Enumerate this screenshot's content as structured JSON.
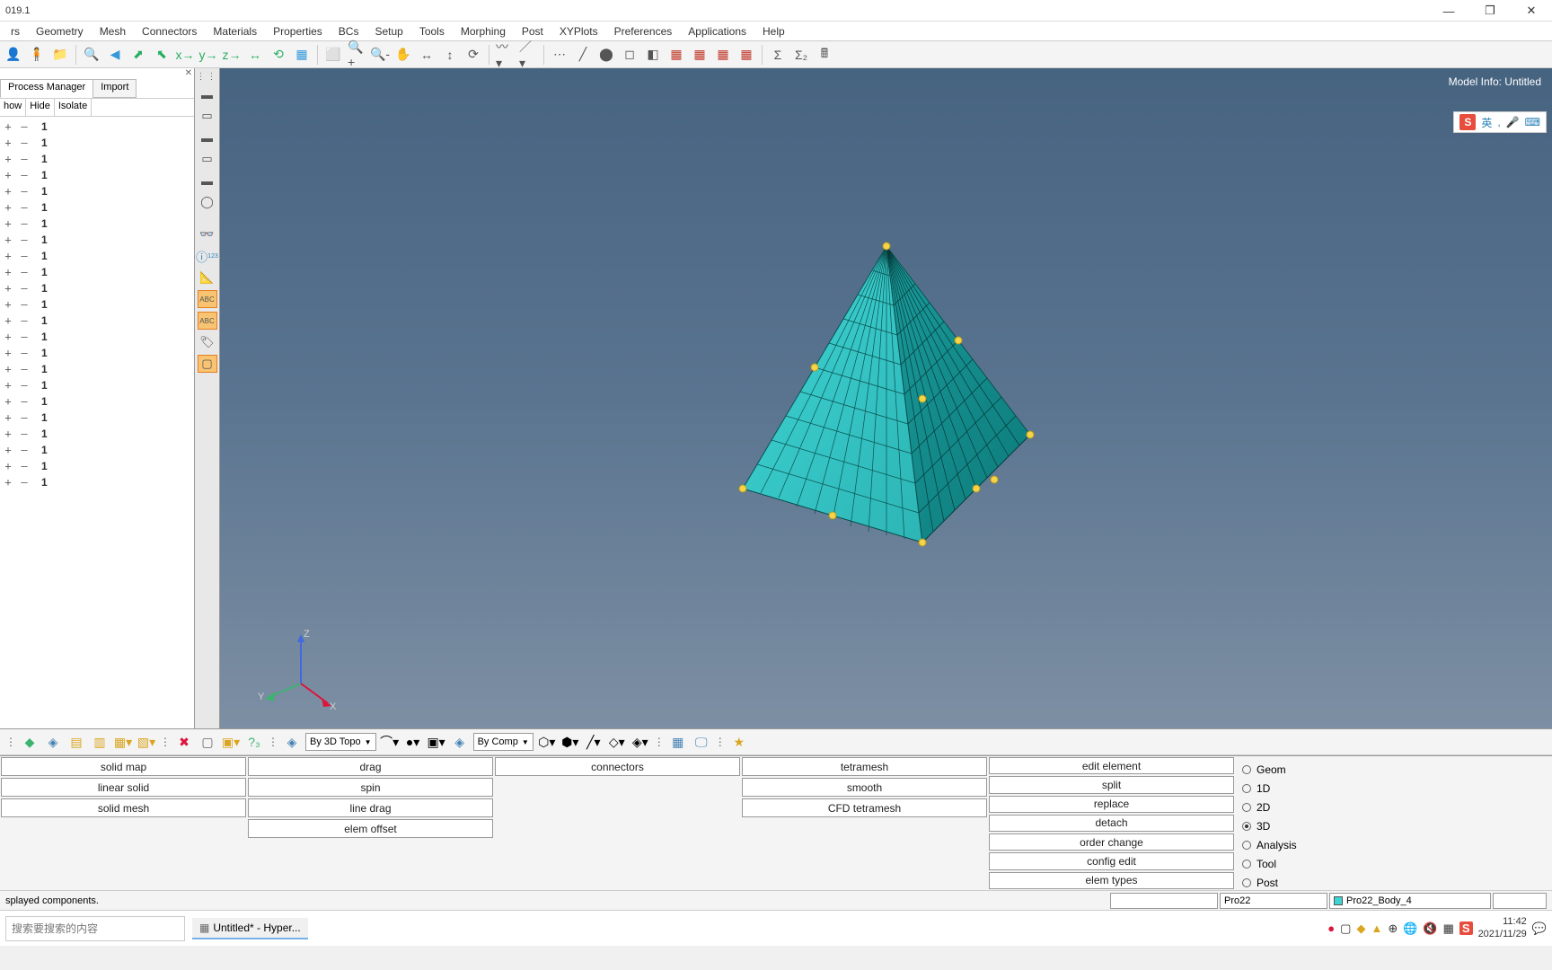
{
  "title": "019.1",
  "menu": [
    "rs",
    "Geometry",
    "Mesh",
    "Connectors",
    "Materials",
    "Properties",
    "BCs",
    "Setup",
    "Tools",
    "Morphing",
    "Post",
    "XYPlots",
    "Preferences",
    "Applications",
    "Help"
  ],
  "left_panel": {
    "tabs": [
      "Process Manager",
      "Import"
    ],
    "filters": [
      "how",
      "Hide",
      "Isolate"
    ],
    "tree_count": 23,
    "tree_value": "1"
  },
  "viewport": {
    "model_info": "Model Info: Untitled",
    "ime": {
      "mark": "S",
      "lang": "英",
      "bits": ",",
      "m1": "🎤",
      "m2": "⌨"
    },
    "axes": {
      "x": "X",
      "y": "Y",
      "z": "Z"
    }
  },
  "bottom_combo1": "By 3D Topo",
  "bottom_combo2": "By Comp",
  "panel": {
    "col1": [
      "solid map",
      "linear solid",
      "solid mesh"
    ],
    "col2": [
      "drag",
      "spin",
      "line drag",
      "elem offset"
    ],
    "col3": [
      "connectors"
    ],
    "col4": [
      "tetramesh",
      "smooth",
      "CFD tetramesh"
    ],
    "col5": [
      "edit element",
      "split",
      "replace",
      "detach",
      "order change",
      "config edit",
      "elem types"
    ],
    "radios": [
      "Geom",
      "1D",
      "2D",
      "3D",
      "Analysis",
      "Tool",
      "Post"
    ],
    "radio_selected": 3
  },
  "status": {
    "msg": "splayed components.",
    "box1": "",
    "box2": "Pro22",
    "box3": "Pro22_Body_4"
  },
  "taskbar": {
    "search": "搜索要搜索的内容",
    "task": "Untitled* - Hyper...",
    "time": "11:42",
    "date": "2021/11/29"
  }
}
